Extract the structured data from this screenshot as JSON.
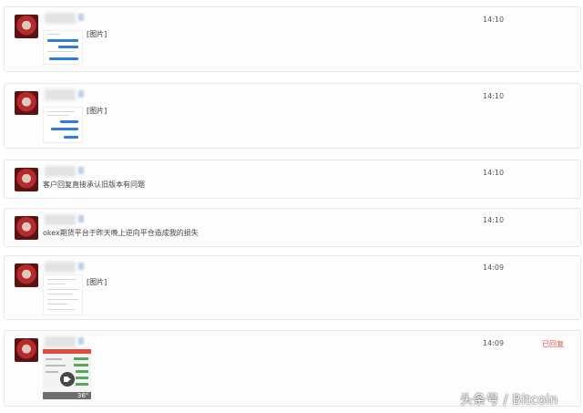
{
  "messages": [
    {
      "time": "14:10",
      "type": "image",
      "text": "[图片]",
      "status": ""
    },
    {
      "time": "14:10",
      "type": "image",
      "text": "[图片]",
      "status": ""
    },
    {
      "time": "14:10",
      "type": "text",
      "text": "客户回复直接承认旧版本有问题",
      "status": ""
    },
    {
      "time": "14:10",
      "type": "text",
      "text": "okex期货平台于昨天晚上逆向平仓造成我的损失",
      "status": ""
    },
    {
      "time": "14:09",
      "type": "image",
      "text": "[图片]",
      "status": ""
    },
    {
      "time": "14:09",
      "type": "video",
      "text": "",
      "status": "已回复",
      "duration": "36\""
    }
  ],
  "watermark": "头条号 / Bitcoin",
  "colors": {
    "status": "#e14a4a",
    "bubble": "#2d7be0",
    "video_header": "#e44b3b"
  }
}
